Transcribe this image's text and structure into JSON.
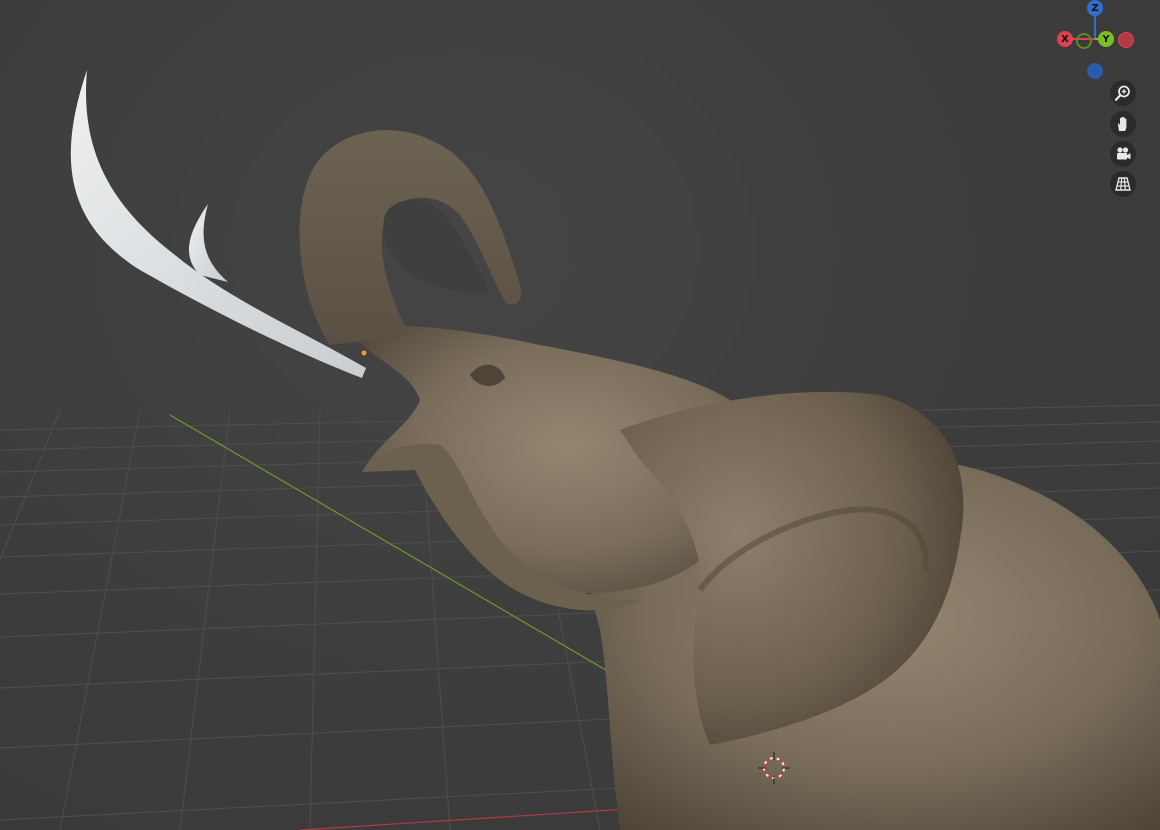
{
  "viewport": {
    "background": "#3d3d3d",
    "grid_color": "#505050",
    "x_axis_color": "#b33a42",
    "y_axis_color": "#6f9a2c"
  },
  "gizmo": {
    "z_label": "Z",
    "x_label": "X",
    "y_label": "Y",
    "z_color": "#2f6fd0",
    "x_color": "#e0404f",
    "y_color": "#7cbf22",
    "neg_x_color": "#b43a45",
    "neg_y_color": "#5f8a24",
    "neg_z_color": "#2b5ba8"
  },
  "nav_tools": [
    {
      "name": "zoom",
      "icon": "zoom-icon"
    },
    {
      "name": "pan",
      "icon": "hand-icon"
    },
    {
      "name": "camera",
      "icon": "camera-icon"
    },
    {
      "name": "perspective",
      "icon": "grid-icon"
    }
  ],
  "model": {
    "object": "elephant",
    "tusk_color": "#d8dcdf",
    "skin_color": "#7b6e5c"
  }
}
